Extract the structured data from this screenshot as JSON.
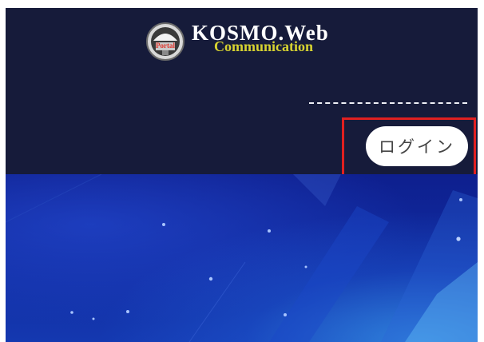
{
  "header": {
    "logo": {
      "title": "KOSMO.Web",
      "subtitle": "Communication",
      "emblem_text": "Portal"
    }
  },
  "login": {
    "label": "ログイン"
  },
  "colors": {
    "header_bg": "#161b3a",
    "hero_bg": "#1030a0",
    "highlight": "#e02020",
    "subtitle": "#d7d331"
  }
}
